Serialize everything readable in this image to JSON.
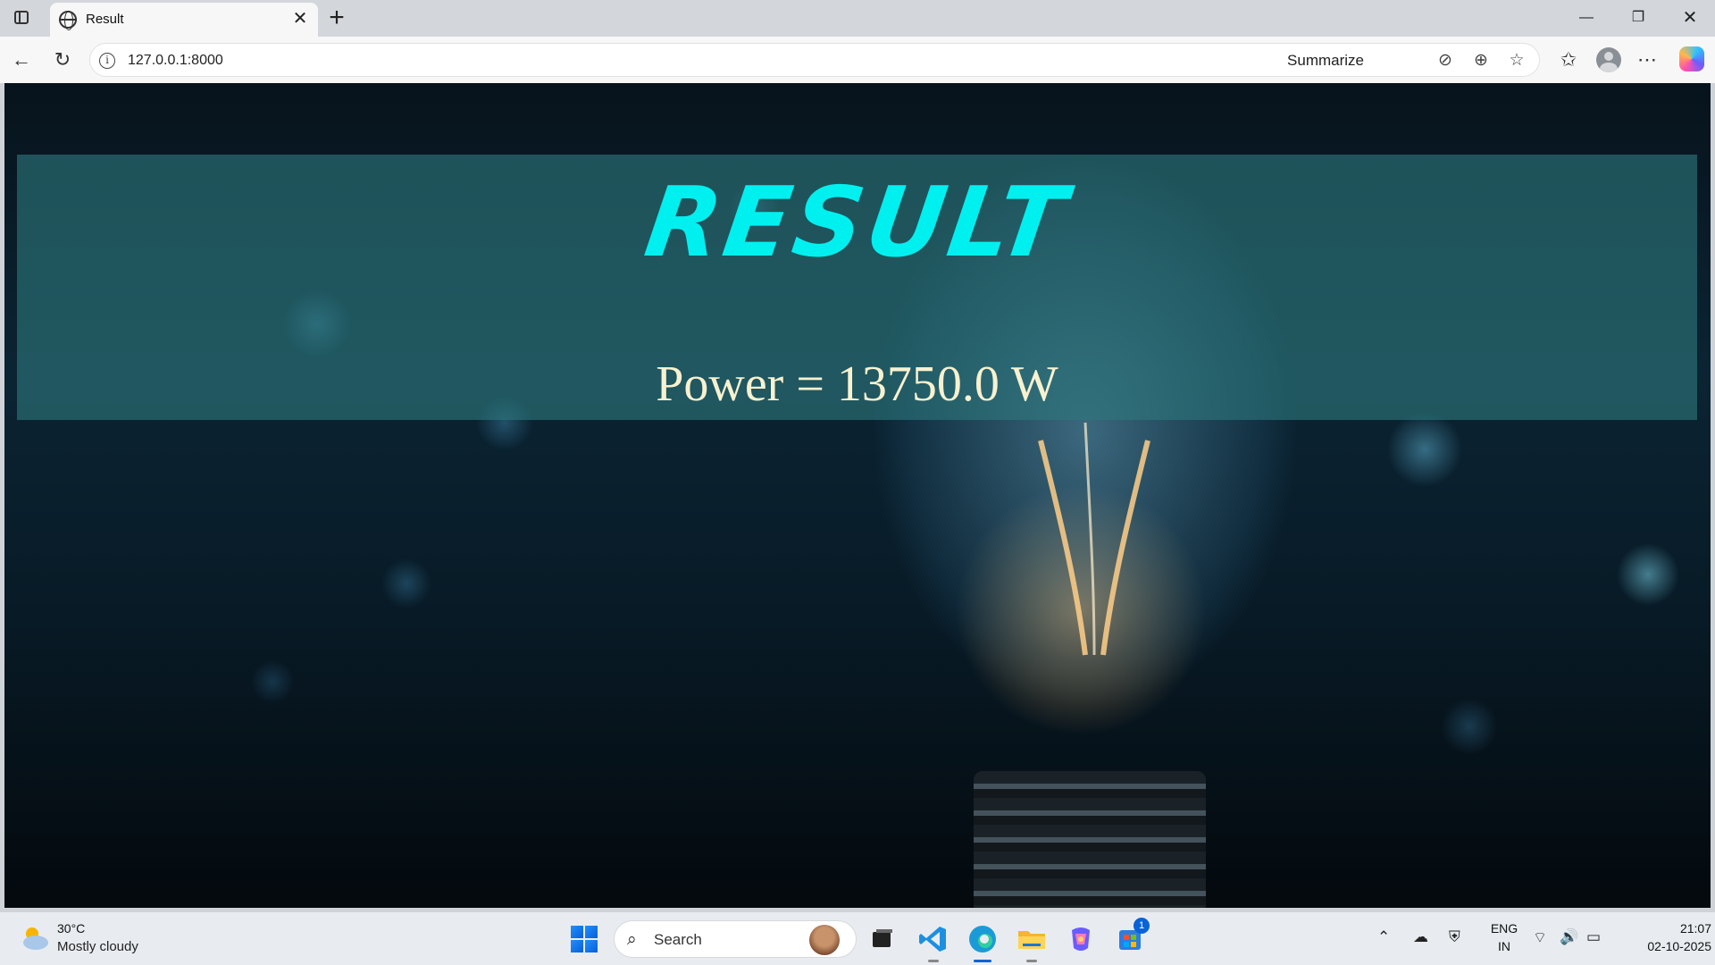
{
  "browser": {
    "tab_title": "Result",
    "url": "127.0.0.1:8000",
    "summarize_label": "Summarize"
  },
  "page": {
    "heading": "RESULT",
    "power_text": "Power = 13750.0 W"
  },
  "taskbar": {
    "weather_temp": "30°C",
    "weather_desc": "Mostly cloudy",
    "search_label": "Search",
    "store_badge": "1",
    "lang_line1": "ENG",
    "lang_line2": "IN",
    "time": "21:07",
    "date": "02-10-2025"
  },
  "colors": {
    "heading": "#00f0f0",
    "power_text": "#f8f1cf",
    "banner": "#2d787d"
  }
}
